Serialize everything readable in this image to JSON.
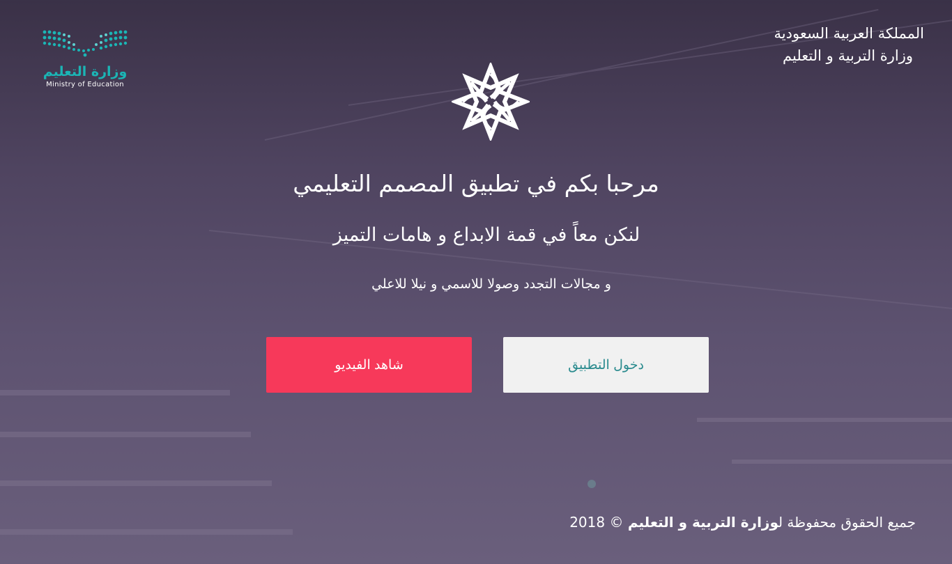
{
  "header": {
    "country": "المملكة العربية السعودية",
    "ministry": "وزارة التربية و التعليم"
  },
  "logo": {
    "arabic": "وزارة التعليم",
    "english": "Ministry of Education",
    "dots_icon": "moe-dots-logo",
    "colors": {
      "teal": "#1bb5b5",
      "teal_light": "#5fd0d0"
    }
  },
  "emblem": {
    "icon": "rosette-star-emblem"
  },
  "hero": {
    "title": "مرحبا بكم في تطبيق المصمم التعليمي",
    "subtitle": "لنكن معاً في قمة الابداع و هامات التميز",
    "tagline": "و مجالات التجدد وصولا للاسمي و نيلا للاعلي"
  },
  "buttons": {
    "watch_video": "شاهد الفيديو",
    "enter_app": "دخول التطبيق"
  },
  "colors": {
    "video_button": "#f7395a",
    "enter_button_bg": "#f1f1f1",
    "enter_button_text": "#2a8b8e"
  },
  "footer": {
    "prefix": "جميع الحقوق محفوظة ل",
    "ministry": "وزارة التربية و التعليم",
    "year": "© 2018"
  }
}
